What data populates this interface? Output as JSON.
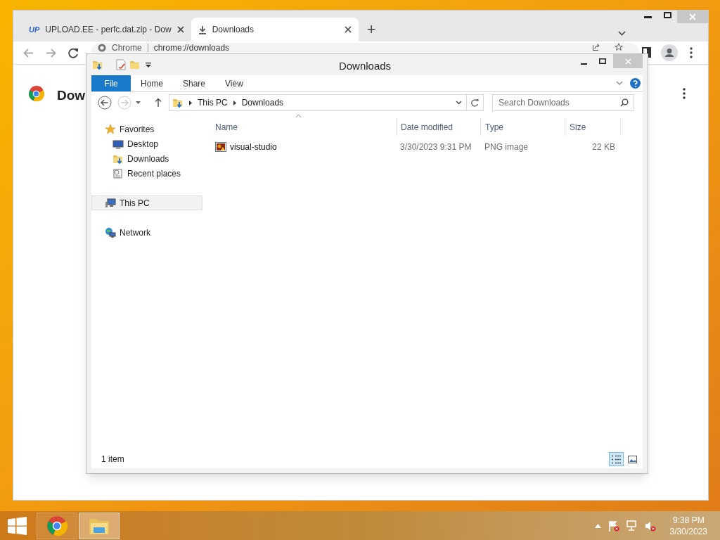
{
  "chrome": {
    "tabs": [
      {
        "title": "UPLOAD.EE - perfc.dat.zip - Dow",
        "favicon": "UP",
        "selected": false
      },
      {
        "title": "Downloads",
        "selected": true
      }
    ],
    "new_tab": "+",
    "omnibox": {
      "site": "Chrome",
      "url": "chrome://downloads"
    },
    "page_heading": "Dow"
  },
  "explorer": {
    "title": "Downloads",
    "ribbon_tabs": [
      {
        "label": "File",
        "kind": "file"
      },
      {
        "label": "Home",
        "kind": "tab"
      },
      {
        "label": "Share",
        "kind": "tab"
      },
      {
        "label": "View",
        "kind": "tab"
      }
    ],
    "breadcrumb": [
      "This PC",
      "Downloads"
    ],
    "search": {
      "placeholder": "Search Downloads"
    },
    "nav": [
      {
        "label": "Favorites",
        "selected": false,
        "children": [
          {
            "label": "Desktop",
            "selected": false
          },
          {
            "label": "Downloads",
            "selected": false
          },
          {
            "label": "Recent places",
            "selected": false
          }
        ]
      },
      {
        "label": "This PC",
        "selected": true
      },
      {
        "label": "Network",
        "selected": false
      }
    ],
    "columns": [
      "Name",
      "Date modified",
      "Type",
      "Size"
    ],
    "rows": [
      {
        "name": "visual-studio",
        "date": "3/30/2023 9:31 PM",
        "type": "PNG image",
        "size": "22 KB"
      }
    ],
    "status": "1 item",
    "views": [
      {
        "kind": "details",
        "selected": true
      },
      {
        "kind": "thumbnails",
        "selected": false
      }
    ]
  },
  "taskbar": {
    "apps": [
      {
        "kind": "chrome",
        "selected": false
      },
      {
        "kind": "explorer",
        "selected": true
      }
    ],
    "time": "9:38 PM",
    "date": "3/30/2023"
  }
}
